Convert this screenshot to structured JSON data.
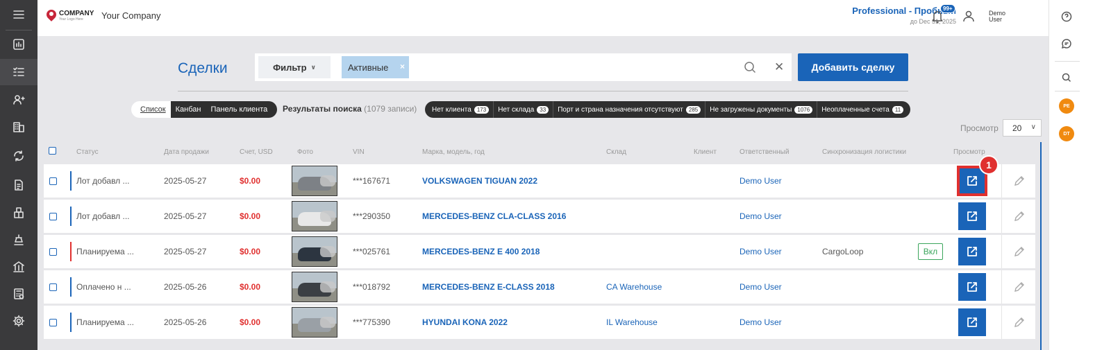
{
  "company": {
    "logo_text": "COMPANY",
    "logo_sub": "Your Logo Here",
    "name": "Your Company"
  },
  "plan": {
    "name": "Professional - Пробный",
    "until": "до Dec 31, 2025"
  },
  "notifications": {
    "badge": "99+"
  },
  "user": {
    "line1": "Demo",
    "line2": "User"
  },
  "right_bar": {
    "avatars": [
      "PE",
      "DT"
    ]
  },
  "page": {
    "title": "Сделки"
  },
  "search": {
    "filter_label": "Фильтр",
    "chip_label": "Активные",
    "chip_remove": "×",
    "clear": "✕"
  },
  "add_button": "Добавить сделку",
  "views": {
    "list": "Список",
    "kanban": "Канбан",
    "client_panel": "Панель клиента"
  },
  "results": {
    "label": "Результаты поиска",
    "count": "(1079 записи)"
  },
  "quick_filters": [
    {
      "label": "Нет клиента",
      "count": "173"
    },
    {
      "label": "Нет склада",
      "count": "33"
    },
    {
      "label": "Порт и страна назначения отсутствуют",
      "count": "285"
    },
    {
      "label": "Не загружены документы",
      "count": "1076"
    },
    {
      "label": "Неоплаченные счета",
      "count": "11"
    }
  ],
  "per_page": {
    "label": "Просмотр",
    "value": "20"
  },
  "columns": {
    "status": "Статус",
    "sale_date": "Дата продажи",
    "invoice": "Счет, USD",
    "photo": "Фото",
    "vin": "VIN",
    "model": "Марка, модель, год",
    "warehouse": "Склад",
    "client": "Клиент",
    "responsible": "Ответственный",
    "sync": "Синхронизация логистики",
    "view": "Просмотр"
  },
  "rows": [
    {
      "status": "Лот добавл ...",
      "status_color": "#1a64b8",
      "date": "2025-05-27",
      "amount": "$0.00",
      "vin": "***167671",
      "model": "VOLKSWAGEN TIGUAN 2022",
      "warehouse": "",
      "client": "",
      "responsible": "Demo User",
      "sync": "",
      "toggle": "",
      "car_color": "#7d8186"
    },
    {
      "status": "Лот добавл ...",
      "status_color": "#1a64b8",
      "date": "2025-05-27",
      "amount": "$0.00",
      "vin": "***290350",
      "model": "MERCEDES-BENZ CLA-CLASS 2016",
      "warehouse": "",
      "client": "",
      "responsible": "Demo User",
      "sync": "",
      "toggle": "",
      "car_color": "#e8e8e8"
    },
    {
      "status": "Планируема ...",
      "status_color": "#e0302f",
      "date": "2025-05-27",
      "amount": "$0.00",
      "vin": "***025761",
      "model": "MERCEDES-BENZ E 400 2018",
      "warehouse": "",
      "client": "",
      "responsible": "Demo User",
      "sync": "CargoLoop",
      "toggle": "Вкл",
      "car_color": "#2c3540"
    },
    {
      "status": "Оплачено н ...",
      "status_color": "#1a64b8",
      "date": "2025-05-26",
      "amount": "$0.00",
      "vin": "***018792",
      "model": "MERCEDES-BENZ E-CLASS 2018",
      "warehouse": "CA Warehouse",
      "client": "",
      "responsible": "Demo User",
      "sync": "",
      "toggle": "",
      "car_color": "#3b3f44"
    },
    {
      "status": "Планируема ...",
      "status_color": "#1a64b8",
      "date": "2025-05-26",
      "amount": "$0.00",
      "vin": "***775390",
      "model": "HYUNDAI KONA 2022",
      "warehouse": "IL Warehouse",
      "client": "",
      "responsible": "Demo User",
      "sync": "",
      "toggle": "",
      "car_color": "#9aa0a6"
    }
  ],
  "step_marker": "1"
}
